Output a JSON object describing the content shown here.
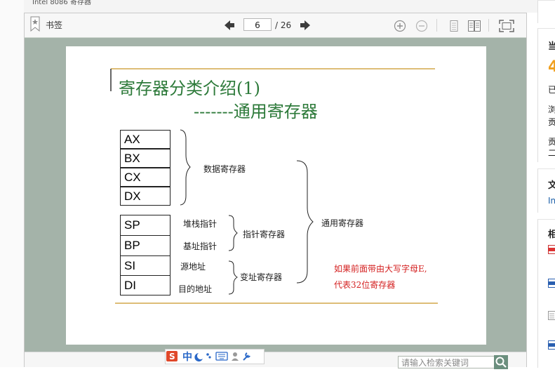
{
  "doc_title_fragment": "Intel 8086 寄存器",
  "toolbar": {
    "bookmark_label": "书签",
    "current_page": "6",
    "total_pages": "/ 26"
  },
  "slide": {
    "title": "寄存器分类介绍(1)",
    "subtitle": "-------通用寄存器",
    "registers_group1": [
      "AX",
      "BX",
      "CX",
      "DX"
    ],
    "registers_group2": [
      "SP",
      "BP",
      "SI",
      "DI"
    ],
    "labels": {
      "data_registers": "数据寄存器",
      "stack_pointer": "堆栈指针",
      "base_pointer": "基址指针",
      "pointer_registers": "指针寄存器",
      "source_address": "源地址",
      "dest_address": "目的地址",
      "index_registers": "变址寄存器",
      "general_registers": "通用寄存器"
    },
    "note_line1": "如果前面带由大写字母E,",
    "note_line2": "代表32位寄存器"
  },
  "bottom": {
    "search_placeholder": "请输入检索关键词"
  },
  "sidebar": {
    "char_1": "当",
    "char_2": "4",
    "char_3": "已",
    "char_4": "浏",
    "char_5": "贡",
    "char_6": "贡",
    "char_7": "二",
    "char_8": "文",
    "char_9": "In",
    "char_10": "相"
  },
  "colors": {
    "title_green": "#2d7a3a",
    "gold_line": "#d4a74a",
    "note_red": "#d42020",
    "viewer_bg": "#a4b3a9"
  }
}
